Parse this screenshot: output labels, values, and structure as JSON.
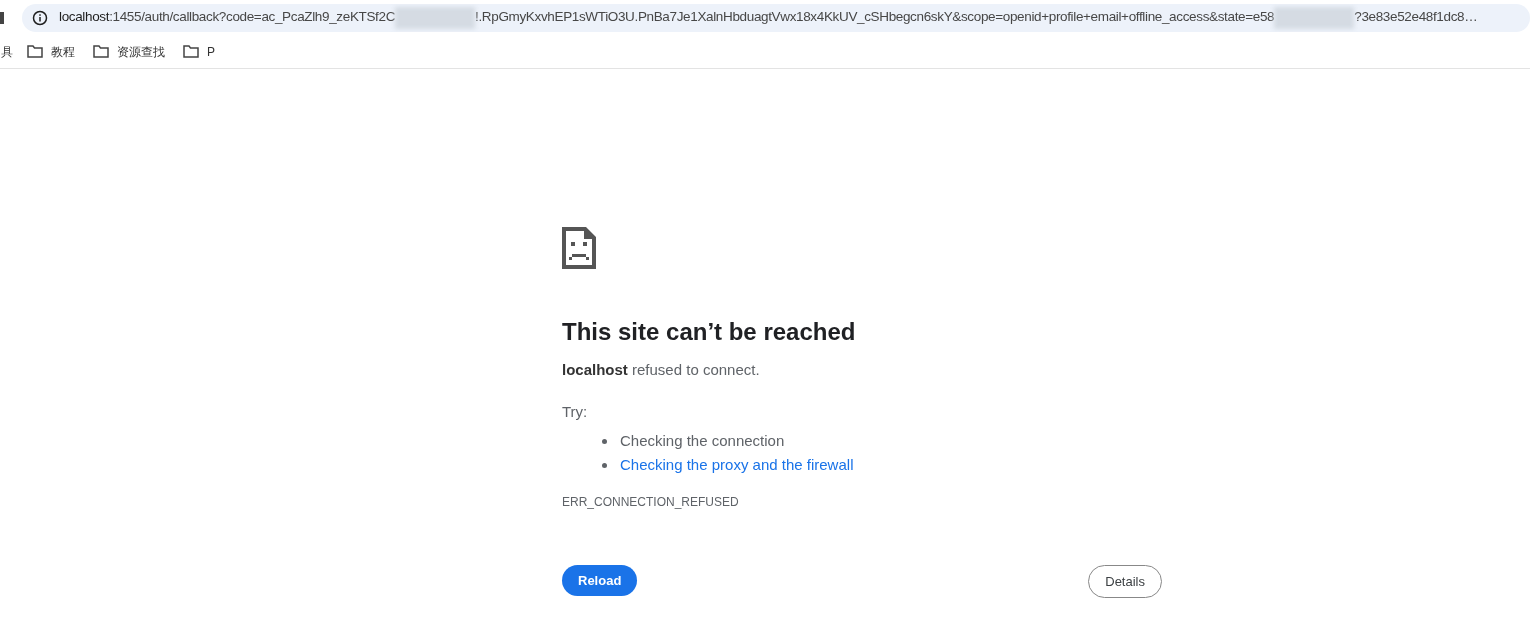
{
  "address_bar": {
    "url_segments": [
      {
        "kind": "host",
        "text": "localhost"
      },
      {
        "kind": "text",
        "text": ":1455/auth/callback?code=ac_PcaZlh9_zeKTSf2C"
      },
      {
        "kind": "redacted"
      },
      {
        "kind": "text",
        "text": "!.RpGmyKxvhEP1sWTiO3U.PnBa7Je1XalnHbduagtVwx18x4KkUV_cSHbegcn6skY&scope=openid+profile+email+offline_access&state=e58"
      },
      {
        "kind": "redacted"
      },
      {
        "kind": "text",
        "text": "?3e83e52e48f1dc8…"
      }
    ]
  },
  "bookmarks": [
    {
      "kind": "cut",
      "label": "具"
    },
    {
      "kind": "folder",
      "label": "教程"
    },
    {
      "kind": "folder",
      "label": "资源查找"
    },
    {
      "kind": "folder",
      "label": "P"
    }
  ],
  "error_page": {
    "heading": "This site can’t be reached",
    "message": "**localhost** refused to connect.",
    "try_label": "Try:",
    "suggestions": [
      {
        "text": "Checking the connection",
        "link": false
      },
      {
        "text": "Checking the proxy and the firewall",
        "link": true
      }
    ],
    "error_code": "ERR_CONNECTION_REFUSED",
    "buttons": [
      {
        "kind": "primary",
        "label": "Reload"
      },
      {
        "kind": "secondary",
        "label": "Details"
      }
    ]
  }
}
